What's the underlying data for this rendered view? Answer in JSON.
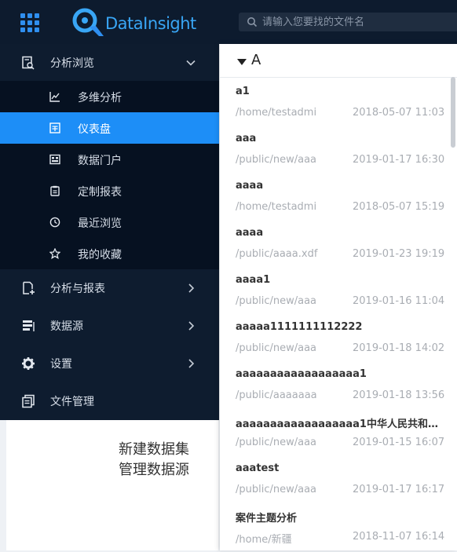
{
  "header": {
    "brand": "DataInsight",
    "search_placeholder": "请输入您要找的文件名"
  },
  "sidebar": {
    "items": [
      {
        "label": "分析浏览",
        "icon": "report-search-icon",
        "expanded": true
      },
      {
        "label": "分析与报表",
        "icon": "add-report-icon"
      },
      {
        "label": "数据源",
        "icon": "datasource-icon"
      },
      {
        "label": "设置",
        "icon": "gear-icon"
      },
      {
        "label": "文件管理",
        "icon": "files-icon"
      }
    ],
    "submenu": [
      {
        "label": "多维分析",
        "icon": "line-chart-icon"
      },
      {
        "label": "仪表盘",
        "icon": "dashboard-icon",
        "active": true
      },
      {
        "label": "数据门户",
        "icon": "portal-icon"
      },
      {
        "label": "定制报表",
        "icon": "custom-report-icon"
      },
      {
        "label": "最近浏览",
        "icon": "clock-icon"
      },
      {
        "label": "我的收藏",
        "icon": "star-icon"
      }
    ]
  },
  "background_links": [
    "新建数据集",
    "管理数据源"
  ],
  "file_panel": {
    "group": "A",
    "files": [
      {
        "name": "a1",
        "path": "/home/testadmi",
        "date": "2018-05-07 11:03"
      },
      {
        "name": "aaa",
        "path": "/public/new/aaa",
        "date": "2019-01-17 16:30"
      },
      {
        "name": "aaaa",
        "path": "/home/testadmi",
        "date": "2018-05-07 15:19"
      },
      {
        "name": "aaaa",
        "path": "/public/aaaa.xdf",
        "date": "2019-01-23 19:19"
      },
      {
        "name": "aaaa1",
        "path": "/public/new/aaa",
        "date": "2019-01-16 11:04"
      },
      {
        "name": "aaaaa1111111112222",
        "path": "/public/new/aaa",
        "date": "2019-01-18 14:02"
      },
      {
        "name": "aaaaaaaaaaaaaaaaaa1",
        "path": "/public/aaaaaaa",
        "date": "2019-01-18 13:56"
      },
      {
        "name": "aaaaaaaaaaaaaaaaaa1中华人民共和…",
        "path": "/public/new/aaa",
        "date": "2019-01-15 16:07"
      },
      {
        "name": "aaatest",
        "path": "/public/new/aaa",
        "date": "2019-01-17 16:17"
      },
      {
        "name": "案件主题分析",
        "path": "/home/新疆",
        "date": "2018-11-07 16:14"
      }
    ]
  },
  "colors": {
    "accent": "#1d8ef7",
    "sidebar_bg": "#0e1c2f",
    "submenu_bg": "#061121"
  }
}
